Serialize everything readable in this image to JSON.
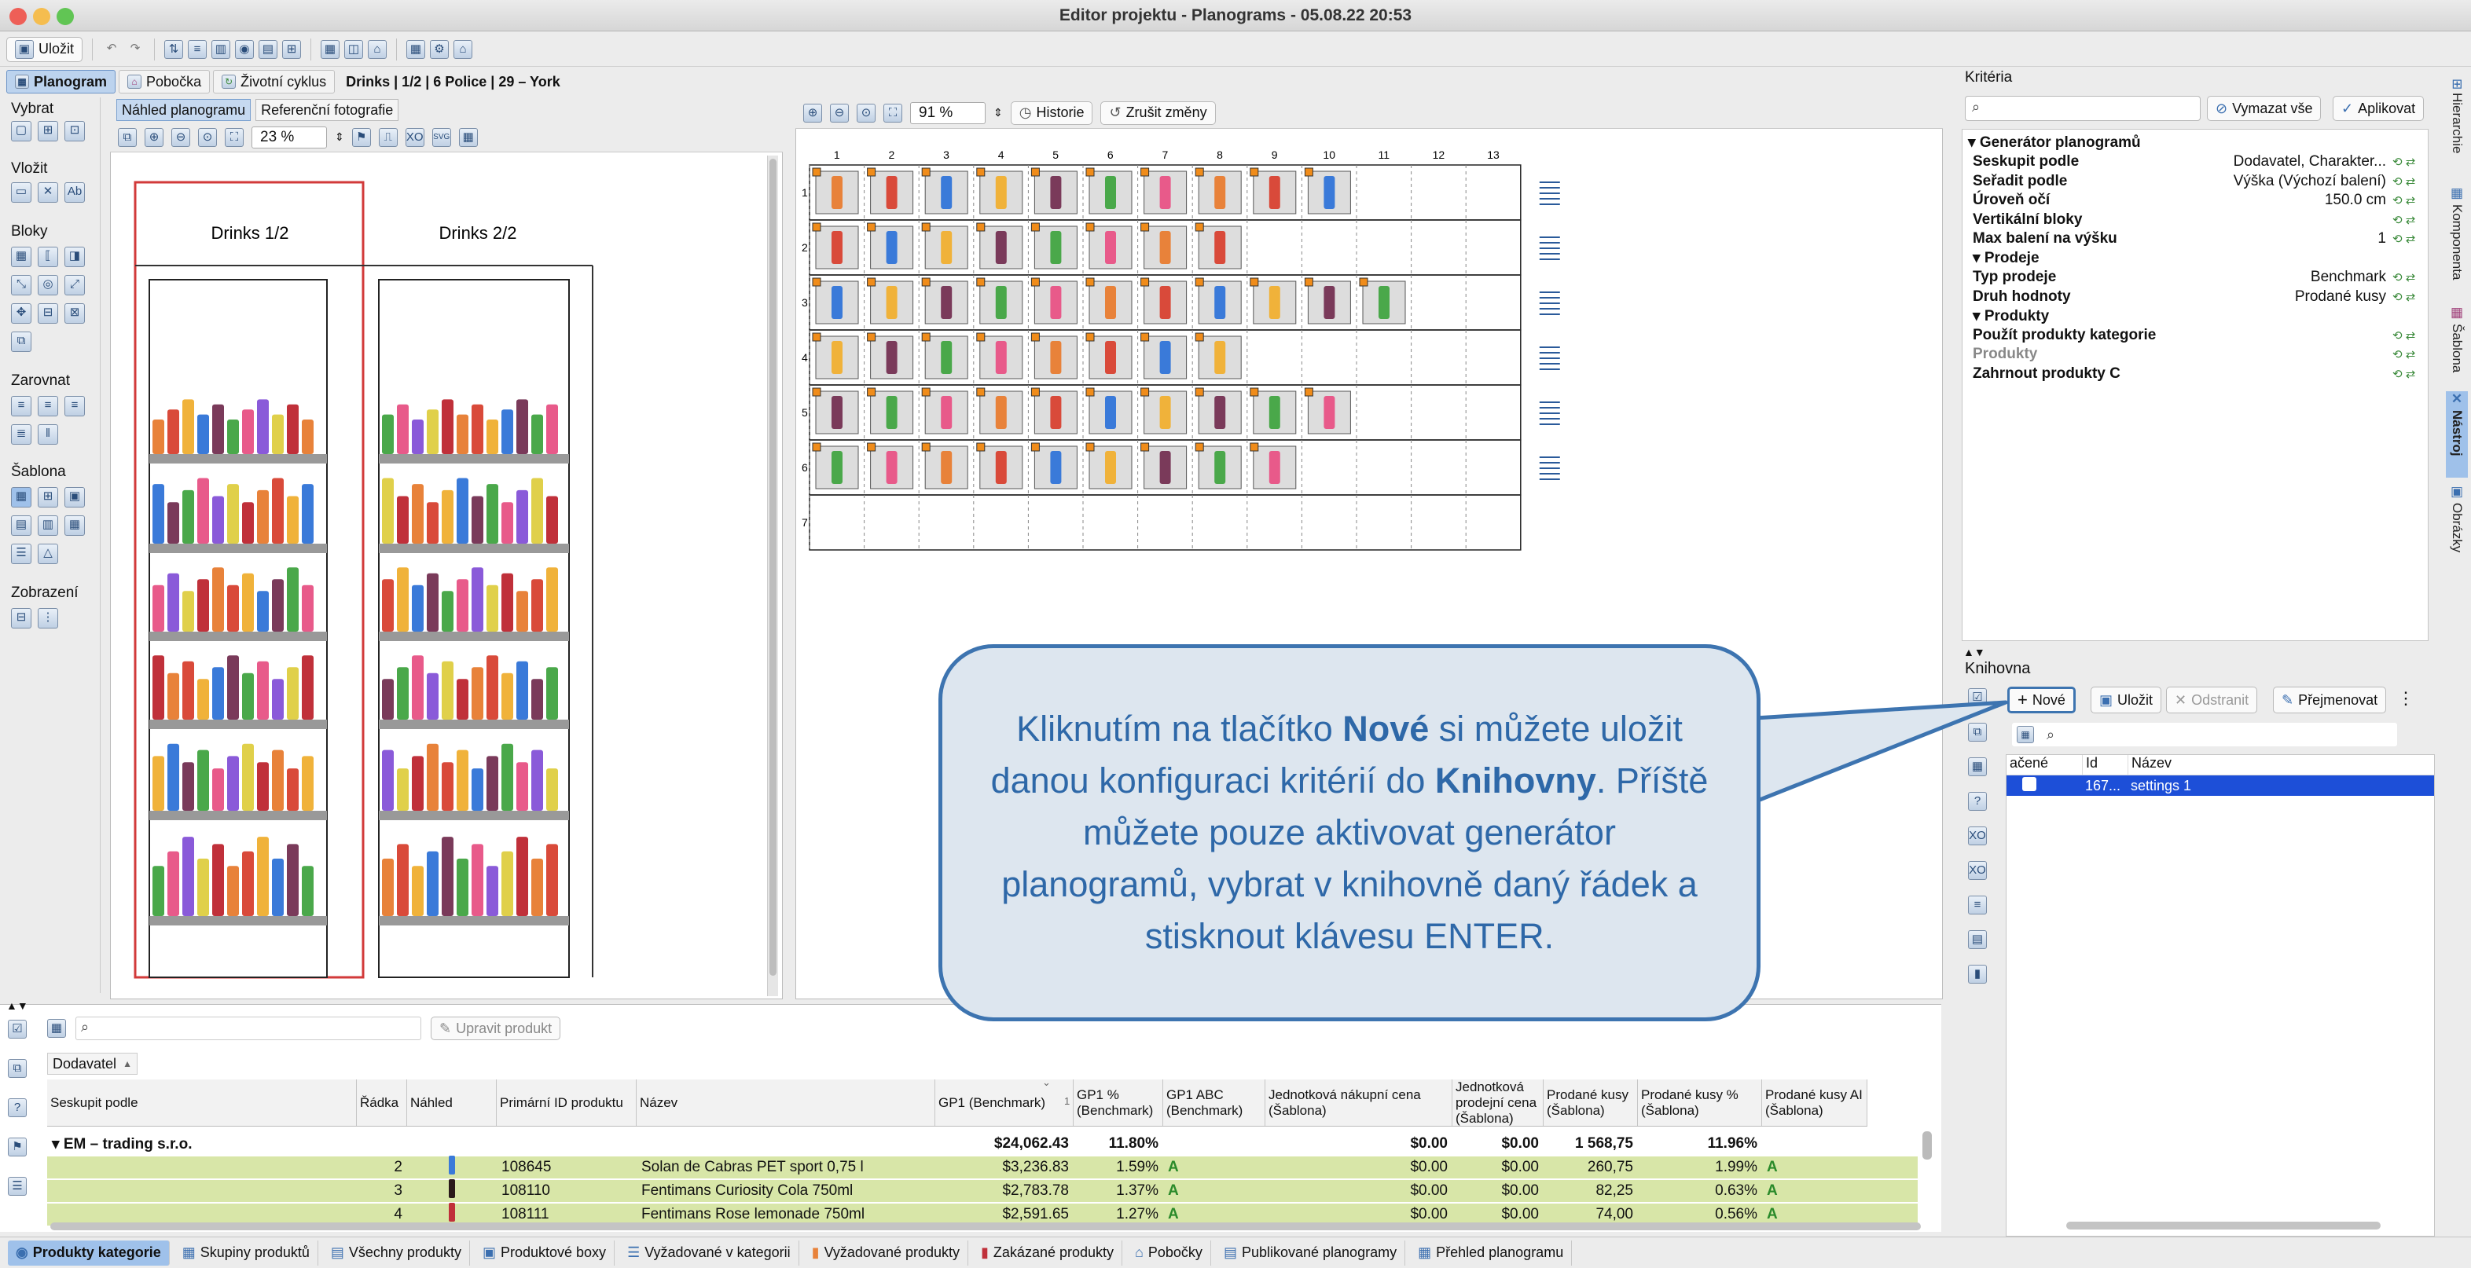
{
  "window": {
    "title": "Editor projektu - Planograms - 05.08.22 20:53"
  },
  "toolbar": {
    "save_label": "Uložit"
  },
  "tabs": [
    {
      "label": "Planogram",
      "active": true
    },
    {
      "label": "Pobočka"
    },
    {
      "label": "Životní cyklus"
    },
    {
      "label": "Drinks | 1/2 | 6 Police | 29 – York"
    }
  ],
  "palette": {
    "vybrat": "Vybrat",
    "vlozit": "Vložit",
    "bloky": "Bloky",
    "zarovnat": "Zarovnat",
    "sablona": "Šablona",
    "zobrazeni": "Zobrazení"
  },
  "left_view": {
    "tab_preview": "Náhled planogramu",
    "tab_photos": "Referenční fotografie",
    "zoom": "23 %",
    "svg_label": "SVG",
    "bay1_title": "Drinks 1/2",
    "bay2_title": "Drinks 2/2"
  },
  "right_view": {
    "zoom": "91 %",
    "history_label": "Historie",
    "undo_label": "Zrušit změny",
    "columns": [
      "1",
      "2",
      "3",
      "4",
      "5",
      "6",
      "7",
      "8",
      "9",
      "10",
      "11",
      "12",
      "13"
    ],
    "rows": [
      "1",
      "2",
      "3",
      "4",
      "5",
      "6",
      "7"
    ],
    "row_fill": [
      10,
      8,
      11,
      8,
      10,
      9,
      0
    ]
  },
  "kriteria": {
    "title": "Kritéria",
    "clear_label": "Vymazat vše",
    "apply_label": "Aplikovat",
    "section_gen": "Generátor planogramů",
    "rows": [
      {
        "key": "Seskupit podle",
        "value": "Dodavatel, Charakter..."
      },
      {
        "key": "Seřadit podle",
        "value": "Výška (Výchozí balení)"
      },
      {
        "key": "Úroveň očí",
        "value": "150.0 cm"
      },
      {
        "key": "Vertikální bloky",
        "value": ""
      },
      {
        "key": "Max balení na výšku",
        "value": "1"
      }
    ],
    "section_sales": "Prodeje",
    "sales_rows": [
      {
        "key": "Typ prodeje",
        "value": "Benchmark"
      },
      {
        "key": "Druh hodnoty",
        "value": "Prodané kusy"
      }
    ],
    "section_products": "Produkty",
    "product_rows": [
      {
        "key": "Použít produkty kategorie",
        "value": ""
      },
      {
        "key": "Produkty",
        "value": ""
      },
      {
        "key": "Zahrnout produkty C",
        "value": ""
      }
    ]
  },
  "knihovna": {
    "title": "Knihovna",
    "new_label": "Nové",
    "save_label": "Uložit",
    "remove_label": "Odstranit",
    "rename_label": "Přejmenovat",
    "col_active": "ačené",
    "col_id": "Id",
    "col_name": "Název",
    "row_id": "167...",
    "row_name": "settings 1"
  },
  "vertical_tabs": [
    "Hierarchie",
    "Komponenta",
    "Šablona",
    "Nástroj",
    "Obrázky"
  ],
  "callout": {
    "part1": "Kliknutím na tlačítko ",
    "bold1": "Nové",
    "part2": " si můžete uložit danou konfiguraci kritérií do ",
    "bold2": "Knihovny",
    "part3": ". Příště můžete pouze aktivovat generátor planogramů, vybrat v knihovně daný řádek a stisknout klávesu ENTER."
  },
  "table": {
    "edit_label": "Upravit produkt",
    "group_label": "Dodavatel",
    "headers": [
      "Seskupit podle",
      "Řádka",
      "Náhled",
      "Primární ID produktu",
      "Název",
      "GP1 (Benchmark)",
      "GP1 % (Benchmark)",
      "GP1 ABC (Benchmark)",
      "Jednotková nákupní cena (Šablona)",
      "Jednotková prodejní cena (Šablona)",
      "Prodané kusy (Šablona)",
      "Prodané kusy % (Šablona)",
      "Prodané kusy AI (Šablona)"
    ],
    "sort_mark": "1",
    "group_row": {
      "name": "EM – trading s.r.o.",
      "gp1": "$24,062.43",
      "gp1p": "11.80%",
      "buy": "$0.00",
      "sell": "$0.00",
      "qty": "1 568,75",
      "qtyp": "11.96%"
    },
    "rows": [
      {
        "line": "2",
        "id": "108645",
        "name": "Solan de Cabras PET sport 0,75 l",
        "gp1": "$3,236.83",
        "gp1p": "1.59%",
        "abc": "A",
        "buy": "$0.00",
        "sell": "$0.00",
        "qty": "260,75",
        "qtyp": "1.99%",
        "ai": "A"
      },
      {
        "line": "3",
        "id": "108110",
        "name": "Fentimans Curiosity Cola 750ml",
        "gp1": "$2,783.78",
        "gp1p": "1.37%",
        "abc": "A",
        "buy": "$0.00",
        "sell": "$0.00",
        "qty": "82,25",
        "qtyp": "0.63%",
        "ai": "A"
      },
      {
        "line": "4",
        "id": "108111",
        "name": "Fentimans Rose lemonade 750ml",
        "gp1": "$2,591.65",
        "gp1p": "1.27%",
        "abc": "A",
        "buy": "$0.00",
        "sell": "$0.00",
        "qty": "74,00",
        "qtyp": "0.56%",
        "ai": "A"
      }
    ]
  },
  "status_tabs": [
    "Produkty kategorie",
    "Skupiny produktů",
    "Všechny produkty",
    "Produktové boxy",
    "Vyžadované v kategorii",
    "Vyžadované produkty",
    "Zakázané produkty",
    "Pobočky",
    "Publikované planogramy",
    "Přehled planogramu"
  ],
  "colors": {
    "accent": "#3d74b0",
    "selected_row": "#1d4fd8",
    "group_row": "#d8e6a8",
    "callout_bg": "#dde6ef"
  }
}
